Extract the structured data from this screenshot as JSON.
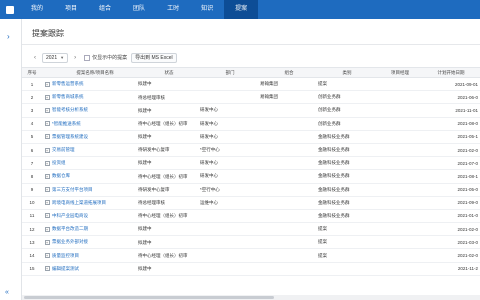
{
  "nav": {
    "tabs": [
      {
        "label": "我的"
      },
      {
        "label": "项目"
      },
      {
        "label": "组合"
      },
      {
        "label": "团队"
      },
      {
        "label": "工时"
      },
      {
        "label": "知识"
      },
      {
        "label": "提案"
      }
    ],
    "active_index": 6,
    "colors": {
      "bar": "#1e6bbf",
      "active": "#0d4d96"
    }
  },
  "page": {
    "title": "提案跟踪"
  },
  "toolbar": {
    "prev": "‹",
    "year": "2021",
    "next": "›",
    "checkbox_label": "仅显示中的提案",
    "export_label": "导出到 MS Excel"
  },
  "table": {
    "headers": [
      "序号",
      "提案名称/项目名称",
      "状态",
      "部门",
      "组合",
      "类别",
      "项目经理",
      "计划开始日期"
    ],
    "rows": [
      {
        "no": "1",
        "name": "新零售运营系统",
        "status": "拟建中",
        "dept": "",
        "cmp": "易翰集团",
        "cat": "提案",
        "mgr": "",
        "date": "2021-09-01"
      },
      {
        "no": "2",
        "name": "新零售商城系统",
        "status": "待总经理审核",
        "dept": "",
        "cmp": "易翰集团",
        "cat": "创新业务群",
        "mgr": "",
        "date": "2021-06-0"
      },
      {
        "no": "3",
        "name": "智能考核分析系统",
        "status": "拟建中",
        "dept": "研发中心",
        "cmp": "",
        "cat": "创新业务群",
        "mgr": "",
        "date": "2021-11-01"
      },
      {
        "no": "4",
        "name": "*智能推送系统",
        "status": "待中心经理（组长）初审",
        "dept": "研发中心",
        "cmp": "",
        "cat": "创新业务群",
        "mgr": "",
        "date": "2021-08-0"
      },
      {
        "no": "5",
        "name": "票据管理系统建设",
        "status": "拟建中",
        "dept": "研发中心",
        "cmp": "",
        "cat": "金融科技业务群",
        "mgr": "",
        "date": "2021-05-1"
      },
      {
        "no": "6",
        "name": "交易前管理",
        "status": "待研发中心复审",
        "dept": "*空行中心",
        "cmp": "",
        "cat": "金融科技业务群",
        "mgr": "",
        "date": "2021-02-0"
      },
      {
        "no": "7",
        "name": "投资组",
        "status": "拟建中",
        "dept": "研发中心",
        "cmp": "",
        "cat": "金融科技业务群",
        "mgr": "",
        "date": "2021-07-0"
      },
      {
        "no": "8",
        "name": "数据仓库",
        "status": "待中心经理（组长）初审",
        "dept": "研发中心",
        "cmp": "",
        "cat": "金融科技业务群",
        "mgr": "",
        "date": "2021-08-1"
      },
      {
        "no": "9",
        "name": "第三方支付平台项目",
        "status": "待研发中心复审",
        "dept": "*空行中心",
        "cmp": "",
        "cat": "金融科技业务群",
        "mgr": "",
        "date": "2021-05-0"
      },
      {
        "no": "10",
        "name": "跨境电商线上渠道拓展项目",
        "status": "待总经理审核",
        "dept": "运维中心",
        "cmp": "",
        "cat": "金融科技业务群",
        "mgr": "",
        "date": "2021-09-0"
      },
      {
        "no": "11",
        "name": "中科产业园电商设",
        "status": "待中心经理（组长）初审",
        "dept": "",
        "cmp": "",
        "cat": "金融科技业务群",
        "mgr": "",
        "date": "2021-01-0"
      },
      {
        "no": "12",
        "name": "数据平台改造二期",
        "status": "拟建中",
        "dept": "",
        "cmp": "",
        "cat": "提案",
        "mgr": "",
        "date": "2021-02-0"
      },
      {
        "no": "13",
        "name": "票据业务外部对接",
        "status": "拟建中",
        "dept": "",
        "cmp": "",
        "cat": "提案",
        "mgr": "",
        "date": "2021-03-0"
      },
      {
        "no": "14",
        "name": "质量监控项目",
        "status": "待中心经理（组长）初审",
        "dept": "",
        "cmp": "",
        "cat": "提案",
        "mgr": "",
        "date": "2021-02-0"
      },
      {
        "no": "15",
        "name": "编辑提案测试",
        "status": "拟建中",
        "dept": "",
        "cmp": "",
        "cat": "",
        "mgr": "",
        "date": "2021-11-2"
      }
    ]
  },
  "icons": {
    "sidebar_toggle": "chevron-right-icon",
    "collapse": "double-chevron-left-icon"
  }
}
